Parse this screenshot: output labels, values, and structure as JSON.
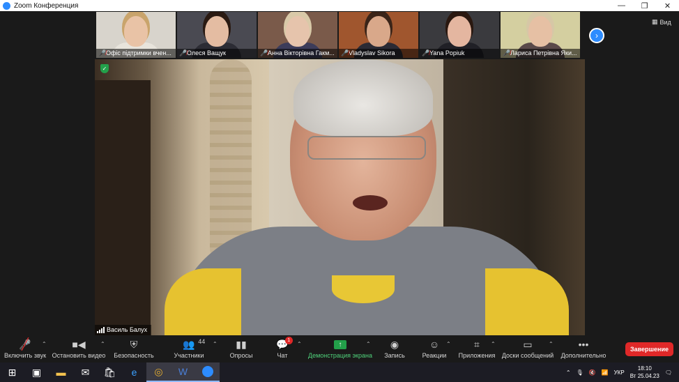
{
  "window": {
    "title": "Zoom Конференция",
    "controls": [
      "—",
      "❐",
      "✕"
    ]
  },
  "gallery": {
    "participants": [
      {
        "name": "Офіс підтримки вчен...",
        "skin": "#e9c3a6",
        "hair": "#c9a46c",
        "bg": "#d8d4cc",
        "clothes": "#e8e4dc"
      },
      {
        "name": "Олеся Ващук",
        "skin": "#e4bca2",
        "hair": "#2a1a12",
        "bg": "#4a4a52",
        "clothes": "#2c2c34"
      },
      {
        "name": "Анна Вікторівна Гакм...",
        "skin": "#e6c4ac",
        "hair": "#d9c9a8",
        "bg": "#7a5a4a",
        "clothes": "#3c3c5a"
      },
      {
        "name": "Vladyslav Sikora",
        "skin": "#d9a88a",
        "hair": "#3a2418",
        "bg": "#a0562e",
        "clothes": "#2a2a34"
      },
      {
        "name": "Yana Popiuk",
        "skin": "#e4b6a0",
        "hair": "#2a1810",
        "bg": "#3a3a3e",
        "clothes": "#202026"
      },
      {
        "name": "Лариса Петрівна Яки...",
        "skin": "#e6c0a4",
        "hair": "#d6c7a6",
        "bg": "#d4cfa0",
        "clothes": "#5a4a4a"
      }
    ],
    "next_icon": "chevron-right-icon",
    "view_label": "Вид"
  },
  "speaker": {
    "name": "Василь Балух"
  },
  "toolbar": {
    "mute": "Включить звук",
    "video": "Остановить видео",
    "security": "Безопасность",
    "participants": "Участники",
    "participants_count": "44",
    "polls": "Опросы",
    "chat": "Чат",
    "chat_badge": "1",
    "share": "Демонстрация экрана",
    "record": "Запись",
    "reactions": "Реакции",
    "apps": "Приложения",
    "whiteboards": "Доски сообщений",
    "more": "Дополнительно",
    "end": "Завершение"
  },
  "taskbar": {
    "apps": [
      "windows-start-icon",
      "task-view-icon",
      "file-explorer-icon",
      "mail-icon",
      "store-icon",
      "edge-icon",
      "chrome-icon",
      "word-icon",
      "zoom-icon"
    ],
    "language": "УКР",
    "time": "18:10",
    "date": "Вт 25.04.23"
  },
  "colors": {
    "zoom_blue": "#2d8cff",
    "end_red": "#e02828",
    "share_green": "#23a04a"
  }
}
